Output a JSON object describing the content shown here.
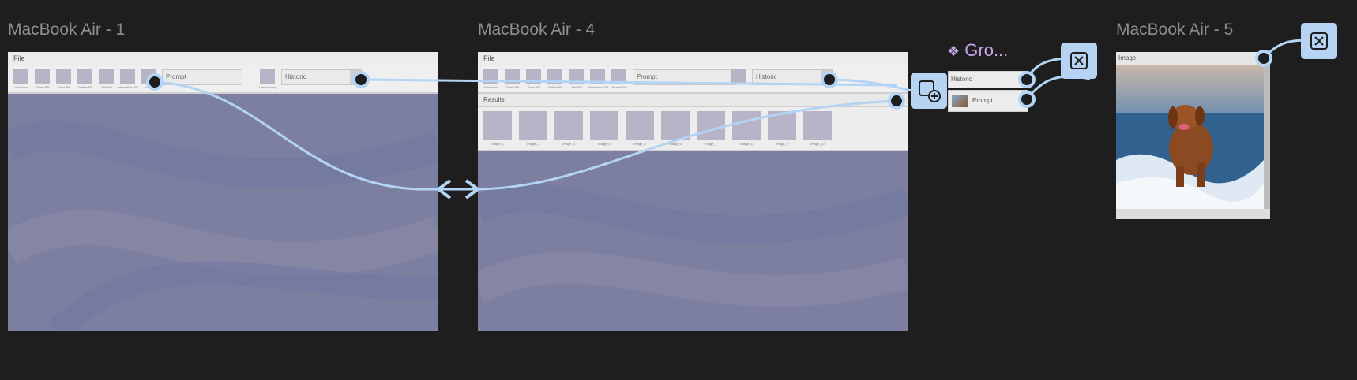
{
  "frames": [
    {
      "title": "MacBook Air - 1",
      "menu_label": "File",
      "tools": [
        "Unicolour",
        "Open SB",
        "Save SB",
        "Delete SB",
        "Add SB",
        "Information SB",
        "Actions"
      ],
      "prompt_placeholder": "Prompt",
      "settings_label": "Unicolouring",
      "historic_label": "Historic",
      "dropdown_glyph": "⌄"
    },
    {
      "title": "MacBook Air - 4",
      "menu_label": "File",
      "tools": [
        "Unicolours",
        "Open SB",
        "Save SB",
        "Delete SB",
        "Add SB",
        "Information SB",
        "Search SB"
      ],
      "prompt_placeholder": "Prompt",
      "historic_label": "Historic",
      "dropdown_glyph": "⌄",
      "results_label": "Results",
      "results": [
        "Image_1",
        "Image_2",
        "Image_3",
        "Image_4",
        "Image_5",
        "Image_6",
        "Image_7",
        "Image_8",
        "Image_9",
        "Image_10"
      ]
    },
    {
      "title": "MacBook Air - 5",
      "image_label": "Image"
    }
  ],
  "group_component": {
    "title": "Gro...",
    "historic_label": "Historic",
    "prompt_label": "Prompt"
  },
  "colors": {
    "canvas": "#1e1e1e",
    "frame_background": "#7c7fa0",
    "connector": "#b3d4f5",
    "component_accent": "#c4a3e6"
  },
  "icons": {
    "group_component": "component-diamond-icon",
    "add_overlay": "overlay-add-icon",
    "close_overlay": "close-icon",
    "bidirectional": "bidirectional-arrow-icon"
  }
}
